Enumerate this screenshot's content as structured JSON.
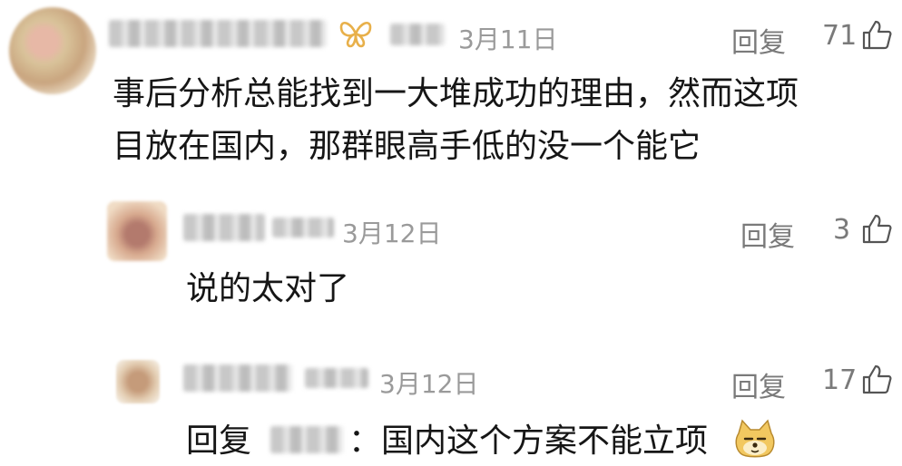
{
  "comments": [
    {
      "date": "3月11日",
      "reply_label": "回复",
      "likes": "71",
      "text_line1": "事后分析总能找到一大堆成功的理由，然而这项",
      "text_line2": "目放在国内，那群眼高手低的没一个能它"
    },
    {
      "date": "3月12日",
      "reply_label": "回复",
      "likes": "3",
      "text": "说的太对了"
    },
    {
      "date": "3月12日",
      "reply_label": "回复",
      "likes": "17",
      "reply_prefix": "回复",
      "reply_text": "：国内这个方案不能立项"
    }
  ],
  "icons": {
    "badge": "butterfly-badge-icon",
    "like": "thumbs-up-icon",
    "emoji": "doge-emoji-icon"
  },
  "colors": {
    "text": "#161616",
    "meta": "#9a9a9a",
    "badge": "#e8b04a"
  }
}
